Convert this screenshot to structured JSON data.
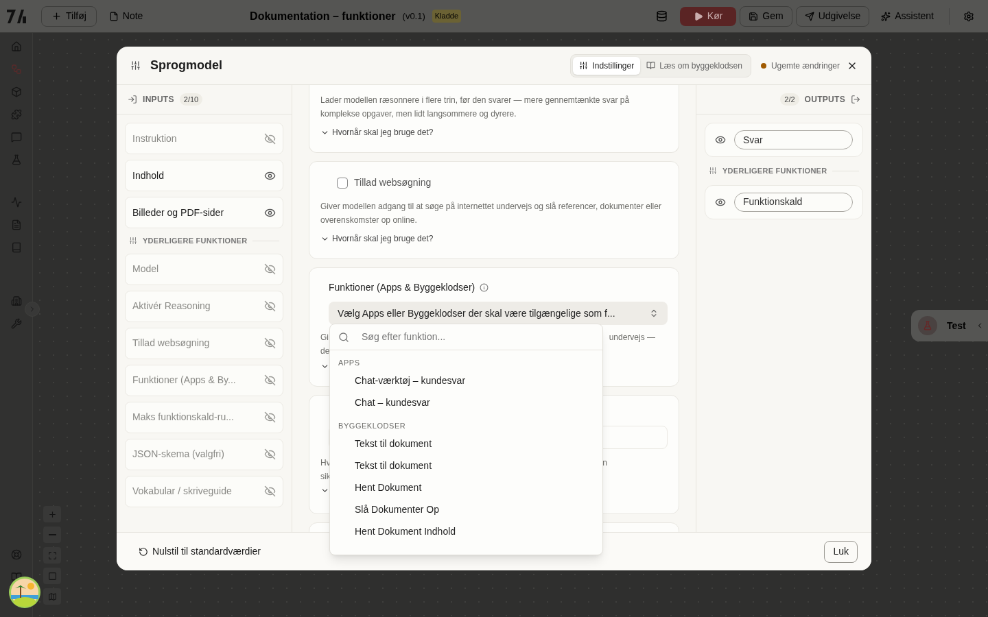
{
  "topbar": {
    "add_button": "Tilføj",
    "note_button": "Note",
    "title": "Dokumentation – funktioner",
    "version": "(v0.1)",
    "status_badge": "Kladde",
    "run_button": "Kør",
    "save_button": "Gem",
    "publish_button": "Udgivelse",
    "assistant_button": "Assistent"
  },
  "test_button": "Test",
  "dialog": {
    "title": "Sprogmodel",
    "tabs": [
      {
        "label": "Indstillinger",
        "selected": true,
        "kind": "settings"
      },
      {
        "label": "Læs om byggeklodsen",
        "selected": false,
        "kind": "docs"
      }
    ],
    "unsaved": "Ugemte ændringer",
    "inputs": {
      "label": "INPUTS",
      "count": "2/10",
      "items": [
        {
          "label": "Instruktion",
          "visible": false
        },
        {
          "label": "Indhold",
          "visible": true
        },
        {
          "label": "Billeder og PDF-sider",
          "visible": true
        }
      ],
      "section": "YDERLIGERE FUNKTIONER",
      "extra_items": [
        {
          "label": "Model",
          "visible": false
        },
        {
          "label": "Aktivér Reasoning",
          "visible": false
        },
        {
          "label": "Tillad websøgning",
          "visible": false
        },
        {
          "label": "Funktioner (Apps & By...",
          "visible": false
        },
        {
          "label": "Maks funktionskald-ru...",
          "visible": false
        },
        {
          "label": "JSON-skema (valgfri)",
          "visible": false
        },
        {
          "label": "Vokabular / skriveguide",
          "visible": false
        }
      ]
    },
    "settings": [
      {
        "kind": "top",
        "description": "Lader modellen ræsonnere i flere trin, før den svarer — mere gennemtænkte svar på komplekse opgaver, men lidt langsommere og dyrere.",
        "help": "Hvornår skal jeg bruge det?"
      },
      {
        "kind": "checkbox",
        "label": "Tillad websøgning",
        "checked": false,
        "description": "Giver modellen adgang til at søge på internettet undervejs og slå referencer, dokumenter eller overenskomster op online.",
        "help": "Hvornår skal jeg bruge det?"
      },
      {
        "kind": "select",
        "label": "Funktioner (Apps & Byggeklodser)",
        "value": "Vælg Apps eller Byggeklodser der skal være tilgængelige som f...",
        "left_fragments": [
          "Gi",
          "de"
        ],
        "right_fragments": [
          "undervejs —"
        ]
      },
      {
        "kind": "hidden",
        "left_fragments": [
          "Hv",
          "sik"
        ],
        "right_fragments": [
          "n"
        ]
      }
    ],
    "dropdown": {
      "placeholder": "Søg efter funktion...",
      "groups": [
        {
          "label": "APPS",
          "options": [
            "Chat-værktøj – kundesvar",
            "Chat – kundesvar"
          ]
        },
        {
          "label": "BYGGEKLODSER",
          "options": [
            "Tekst til dokument",
            "Tekst til dokument",
            "Hent Dokument",
            "Slå Dokumenter Op",
            "Hent Dokument Indhold"
          ]
        }
      ]
    },
    "outputs": {
      "label": "OUTPUTS",
      "count": "2/2",
      "items": [
        {
          "label": "Svar",
          "visible": true
        }
      ],
      "section": "YDERLIGERE FUNKTIONER",
      "extra_items": [
        {
          "label": "Funktionskald",
          "visible": true
        }
      ]
    },
    "reset_button": "Nulstil til standardværdier",
    "close_button": "Luk"
  }
}
